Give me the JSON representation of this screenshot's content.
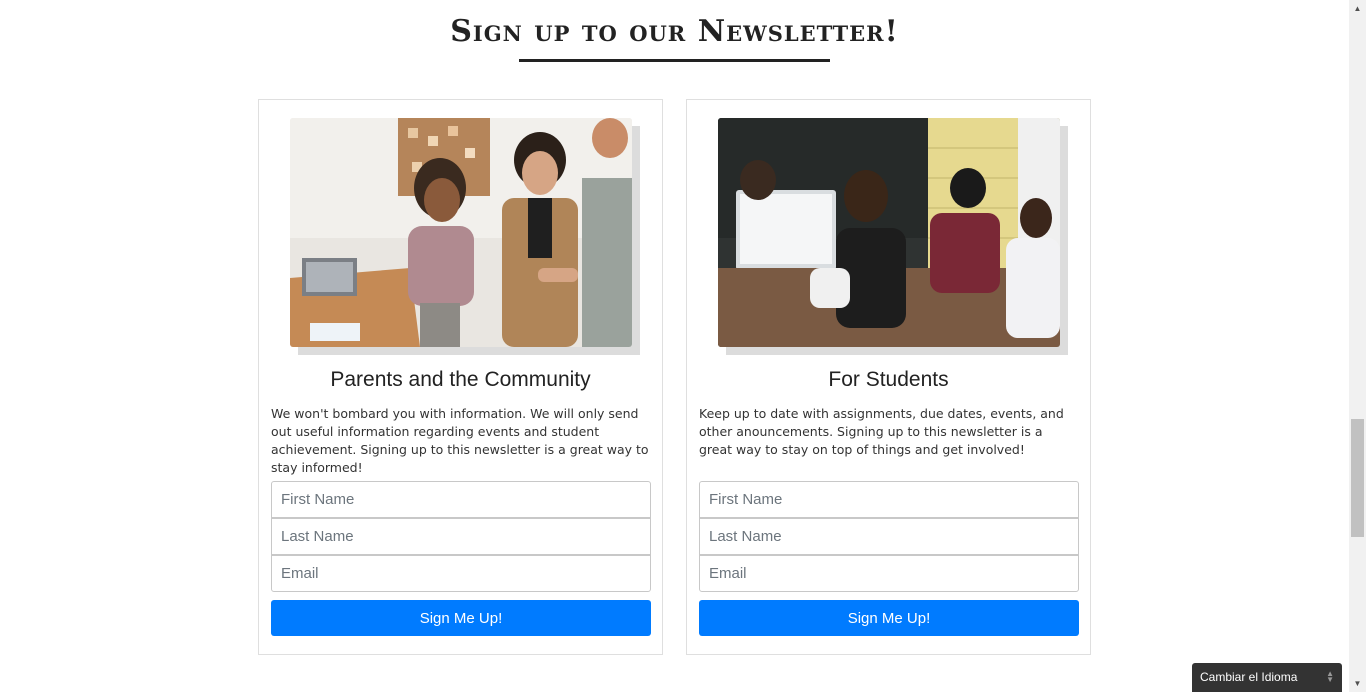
{
  "page": {
    "heading": "Sign up to our Newsletter!"
  },
  "cards": [
    {
      "title": "Parents and the Community",
      "text": "We won't bombard you with information. We will only send out useful information regarding events and student achievement. Signing up to this newsletter is a great way to stay informed!",
      "first_name_placeholder": "First Name",
      "last_name_placeholder": "Last Name",
      "email_placeholder": "Email",
      "button_label": "Sign Me Up!"
    },
    {
      "title": "For Students",
      "text": "Keep up to date with assignments, due dates, events, and other anouncements. Signing up to this newsletter is a great way to stay on top of things and get involved!",
      "first_name_placeholder": "First Name",
      "last_name_placeholder": "Last Name",
      "email_placeholder": "Email",
      "button_label": "Sign Me Up!"
    }
  ],
  "language_widget": {
    "label": "Cambiar el Idioma"
  },
  "colors": {
    "accent": "#007bff",
    "heading": "#222222"
  },
  "icons": {
    "scroll_up": "triangle-up-icon",
    "scroll_down": "triangle-down-icon",
    "language_toggle": "updown-arrows-icon"
  }
}
